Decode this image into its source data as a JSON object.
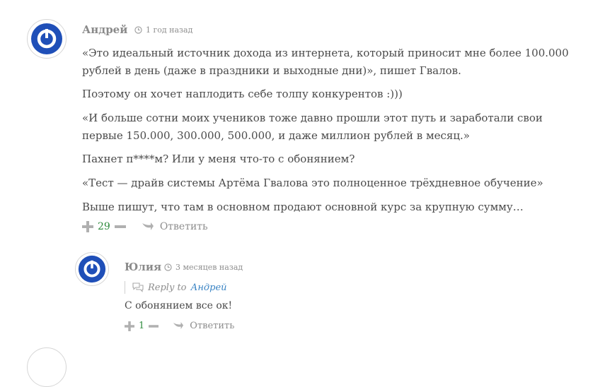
{
  "comments": [
    {
      "author": "Андрей",
      "time": "1 год назад",
      "paragraphs": [
        "«Это идеальный источник дохода из интернета, который приносит мне более 100.000",
        "рублей в день (даже в праздники и выходные дни)», пишет Гвалов.",
        "Поэтому он хочет наплодить себе толпу конкурентов :)))",
        "«И больше сотни моих учеников тоже давно прошли этот путь и заработали свои",
        "первые 150.000, 300.000, 500.000, и даже миллион рублей в месяц.»",
        "Пахнет п****м? Или у меня что-то с обонянием?",
        "«Тест — драйв системы Артёма Гвалова это полноценное трёхдневное обучение»",
        "Выше пишут, что там в основном продают основной курс за крупную сумму…"
      ],
      "votes": "29",
      "reply_label": "Ответить"
    },
    {
      "author": "Юлия",
      "time": "3 месяцев назад",
      "reply_to_label": "Reply to",
      "reply_to_name": "Андрей",
      "text": "С обонянием все ок!",
      "votes": "1",
      "reply_label": "Ответить"
    }
  ],
  "colors": {
    "avatar_blue": "#1f4fb8",
    "vote_green": "#2e8b3d",
    "link_blue": "#3a84c4"
  }
}
